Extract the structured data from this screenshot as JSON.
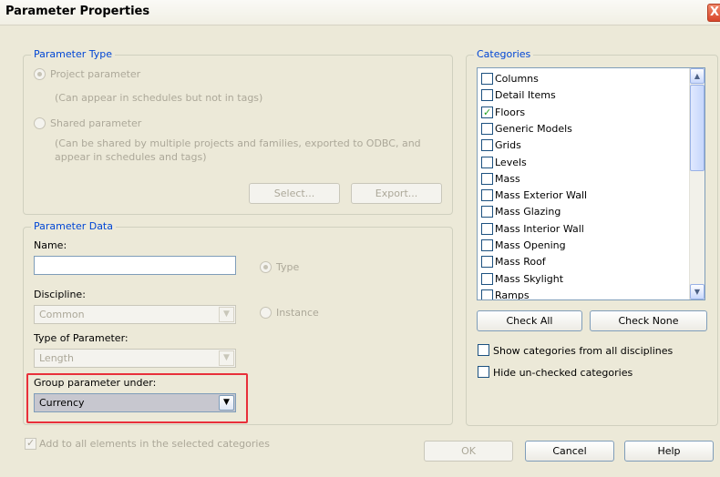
{
  "dialog": {
    "title": "Parameter Properties",
    "close_glyph": "X"
  },
  "parameter_type": {
    "legend": "Parameter Type",
    "project_parameter": "Project parameter",
    "project_note": "(Can appear in schedules but not in tags)",
    "shared_parameter": "Shared parameter",
    "shared_note_line1": "(Can be shared by multiple projects and families, exported to ODBC, and",
    "shared_note_line2": "appear in schedules and tags)",
    "select_button": "Select...",
    "export_button": "Export..."
  },
  "parameter_data": {
    "legend": "Parameter Data",
    "name_label": "Name:",
    "name_value": "",
    "type_radio": "Type",
    "instance_radio": "Instance",
    "discipline_label": "Discipline:",
    "discipline_value": "Common",
    "type_of_parameter_label": "Type of Parameter:",
    "type_of_parameter_value": "Length",
    "group_label": "Group parameter under:",
    "group_value": "Currency"
  },
  "add_to_all": "Add to all elements in the selected categories",
  "categories": {
    "legend": "Categories",
    "items": [
      {
        "label": "Columns",
        "checked": false
      },
      {
        "label": "Detail Items",
        "checked": false
      },
      {
        "label": "Floors",
        "checked": true
      },
      {
        "label": "Generic Models",
        "checked": false
      },
      {
        "label": "Grids",
        "checked": false
      },
      {
        "label": "Levels",
        "checked": false
      },
      {
        "label": "Mass",
        "checked": false
      },
      {
        "label": "Mass Exterior Wall",
        "checked": false
      },
      {
        "label": "Mass Glazing",
        "checked": false
      },
      {
        "label": "Mass Interior Wall",
        "checked": false
      },
      {
        "label": "Mass Opening",
        "checked": false
      },
      {
        "label": "Mass Roof",
        "checked": false
      },
      {
        "label": "Mass Skylight",
        "checked": false
      },
      {
        "label": "Ramps",
        "checked": false
      }
    ],
    "check_all": "Check All",
    "check_none": "Check None",
    "show_all_disciplines": "Show categories from all disciplines",
    "hide_unchecked": "Hide un-checked categories"
  },
  "footer": {
    "ok": "OK",
    "cancel": "Cancel",
    "help": "Help"
  },
  "colors": {
    "accent": "#0046d5",
    "highlight": "#e8303a",
    "background": "#ece9d8"
  }
}
